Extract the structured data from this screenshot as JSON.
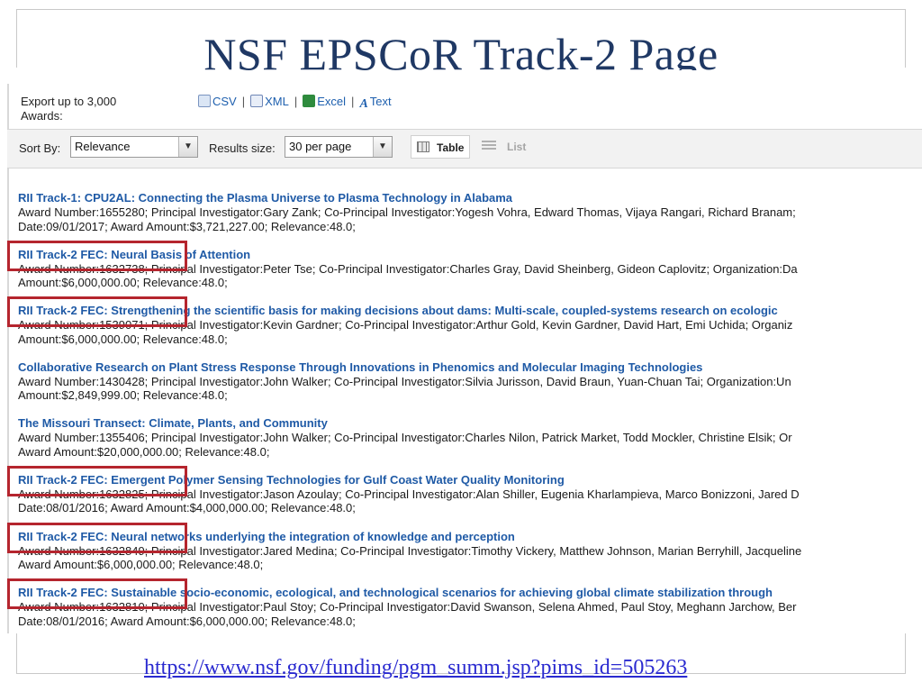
{
  "slide": {
    "title": "NSF EPSCoR Track-2 Page",
    "url": "https://www.nsf.gov/funding/pgm_summ.jsp?pims_id=505263"
  },
  "export": {
    "label": "Export up to 3,000 Awards:",
    "formats": [
      "CSV",
      "XML",
      "Excel",
      "Text"
    ],
    "separator": "|"
  },
  "toolbar": {
    "sort_label": "Sort By:",
    "sort_value": "Relevance",
    "results_label": "Results size:",
    "results_value": "30 per page",
    "view_table": "Table",
    "view_list": "List"
  },
  "results": [
    {
      "title": "RII Track-1: CPU2AL: Connecting the Plasma Universe to Plasma Technology in Alabama",
      "line1": "Award Number:1655280; Principal Investigator:Gary Zank; Co-Principal Investigator:Yogesh Vohra, Edward Thomas, Vijaya Rangari, Richard Branam;",
      "line2": "Date:09/01/2017; Award Amount:$3,721,227.00; Relevance:48.0;",
      "highlighted": false
    },
    {
      "title": "RII Track-2 FEC: Neural Basis of Attention",
      "line1": "Award Number:1632738; Principal Investigator:Peter Tse; Co-Principal Investigator:Charles Gray, David Sheinberg, Gideon Caplovitz; Organization:Da",
      "line2": "Amount:$6,000,000.00; Relevance:48.0;",
      "highlighted": true
    },
    {
      "title": "RII Track-2 FEC: Strengthening the scientific basis for making decisions about dams: Multi-scale, coupled-systems research on ecologic",
      "line1": "Award Number:1539071; Principal Investigator:Kevin Gardner; Co-Principal Investigator:Arthur Gold, Kevin Gardner, David Hart, Emi Uchida; Organiz",
      "line2": "Amount:$6,000,000.00; Relevance:48.0;",
      "highlighted": true
    },
    {
      "title": "Collaborative Research on Plant Stress Response Through Innovations in Phenomics and Molecular Imaging Technologies",
      "line1": "Award Number:1430428; Principal Investigator:John Walker; Co-Principal Investigator:Silvia Jurisson, David Braun, Yuan-Chuan Tai; Organization:Un",
      "line2": "Amount:$2,849,999.00; Relevance:48.0;",
      "highlighted": false
    },
    {
      "title": "The Missouri Transect: Climate, Plants, and Community",
      "line1": "Award Number:1355406; Principal Investigator:John Walker; Co-Principal Investigator:Charles Nilon, Patrick Market, Todd Mockler, Christine Elsik; Or",
      "line2": "Award Amount:$20,000,000.00; Relevance:48.0;",
      "highlighted": false
    },
    {
      "title": "RII Track-2 FEC: Emergent Polymer Sensing Technologies for Gulf Coast Water Quality Monitoring",
      "line1": "Award Number:1632825; Principal Investigator:Jason Azoulay; Co-Principal Investigator:Alan Shiller, Eugenia Kharlampieva, Marco Bonizzoni, Jared D",
      "line2": "Date:08/01/2016; Award Amount:$4,000,000.00; Relevance:48.0;",
      "highlighted": true
    },
    {
      "title": "RII Track-2 FEC: Neural networks underlying the integration of knowledge and perception",
      "line1": "Award Number:1632849; Principal Investigator:Jared Medina; Co-Principal Investigator:Timothy Vickery, Matthew Johnson, Marian Berryhill, Jacqueline",
      "line2": "Award Amount:$6,000,000.00; Relevance:48.0;",
      "highlighted": true
    },
    {
      "title": "RII Track-2 FEC: Sustainable socio-economic, ecological, and technological scenarios for achieving global climate stabilization through",
      "line1": "Award Number:1632810; Principal Investigator:Paul Stoy; Co-Principal Investigator:David Swanson, Selena Ahmed, Paul Stoy, Meghann Jarchow, Ber",
      "line2": "Date:08/01/2016; Award Amount:$6,000,000.00; Relevance:48.0;",
      "highlighted": true
    }
  ],
  "colors": {
    "title": "#1f3864",
    "link": "#1f5aa6",
    "highlight_box": "#b5252e",
    "url": "#2a2ad0"
  }
}
